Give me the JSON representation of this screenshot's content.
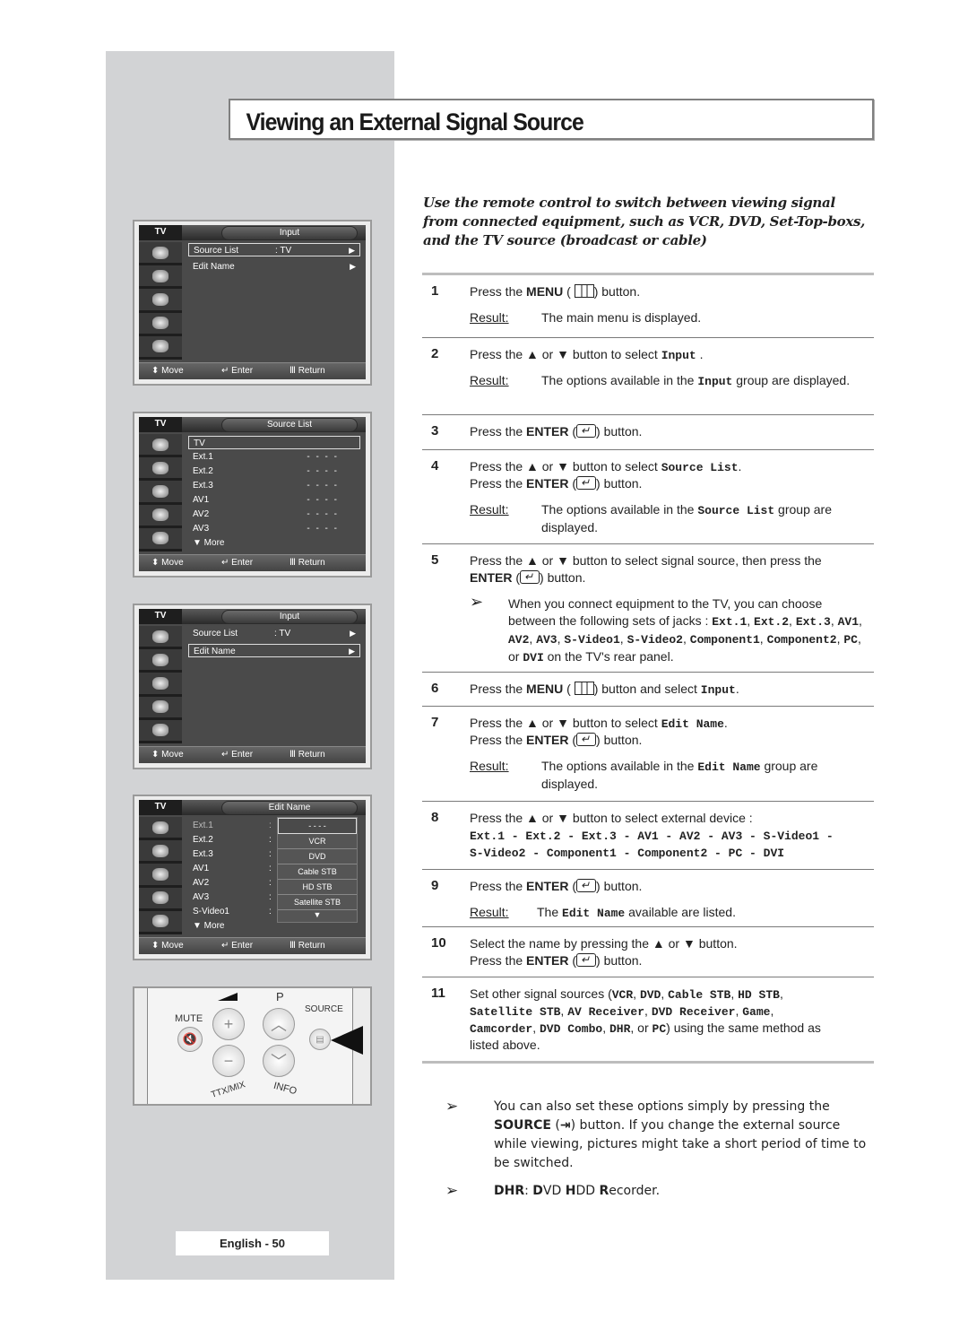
{
  "page": {
    "title": "Viewing an External Signal Source",
    "page_number": "English - 50",
    "intro": "Use the remote control to switch between viewing signal from connected equipment, such as VCR, DVD, Set-Top-boxs, and the TV source (broadcast or cable)"
  },
  "osd_screens": [
    {
      "tv_label": "TV",
      "header": "Input",
      "rows": [
        {
          "label": "Source List",
          "value": ": TV",
          "arrow": "▶",
          "selected": true
        },
        {
          "label": "Edit Name",
          "value": "",
          "arrow": "▶",
          "selected": false
        }
      ],
      "footer": {
        "move": "Move",
        "enter": "Enter",
        "return": "Return"
      }
    },
    {
      "tv_label": "TV",
      "header": "Source List",
      "rows": [
        {
          "label": "TV",
          "value": "",
          "selected": true
        },
        {
          "label": "Ext.1",
          "value": "- - - -"
        },
        {
          "label": "Ext.2",
          "value": "- - - -"
        },
        {
          "label": "Ext.3",
          "value": "- - - -"
        },
        {
          "label": "AV1",
          "value": "- - - -"
        },
        {
          "label": "AV2",
          "value": "- - - -"
        },
        {
          "label": "AV3",
          "value": "- - - -"
        },
        {
          "label": "▼ More",
          "value": ""
        }
      ],
      "footer": {
        "move": "Move",
        "enter": "Enter",
        "return": "Return"
      }
    },
    {
      "tv_label": "TV",
      "header": "Input",
      "rows": [
        {
          "label": "Source List",
          "value": ": TV",
          "arrow": "▶",
          "selected": false
        },
        {
          "label": "Edit Name",
          "value": "",
          "arrow": "▶",
          "selected": true
        }
      ],
      "footer": {
        "move": "Move",
        "enter": "Enter",
        "return": "Return"
      }
    },
    {
      "tv_label": "TV",
      "header": "Edit Name",
      "rows": [
        {
          "label": "Ext.1",
          "colon": ":"
        },
        {
          "label": "Ext.2",
          "colon": ":"
        },
        {
          "label": "Ext.3",
          "colon": ":"
        },
        {
          "label": "AV1",
          "colon": ":"
        },
        {
          "label": "AV2",
          "colon": ":"
        },
        {
          "label": "AV3",
          "colon": ":"
        },
        {
          "label": "S-Video1",
          "colon": ":"
        },
        {
          "label": "▼ More",
          "colon": ""
        }
      ],
      "dropdown": {
        "current": "- - - -",
        "options": [
          "VCR",
          "DVD",
          "Cable STB",
          "HD STB",
          "Satellite STB"
        ],
        "more": "▼"
      },
      "footer": {
        "move": "Move",
        "enter": "Enter",
        "return": "Return"
      }
    }
  ],
  "remote": {
    "mute": "MUTE",
    "p": "P",
    "source": "SOURCE",
    "ttx": "TTX/MIX",
    "info": "INFO",
    "vol_up": "+",
    "vol_down": "−",
    "ch_up": "︿",
    "ch_down": "﹀"
  },
  "steps": [
    {
      "num": "1",
      "lines": [
        "Press the <b>MENU</b> ( <i class='menu-ico'></i>) button."
      ],
      "result": "The main menu is displayed."
    },
    {
      "num": "2",
      "lines": [
        "Press the ▲ or ▼ button to select <span class='mono'>Input</span> ."
      ],
      "result": "The options available in the <span class='mono'>Input</span> group are displayed."
    },
    {
      "num": "3",
      "lines": [
        "Press the <b>ENTER</b> (<i class='enter-ico'></i>) button."
      ]
    },
    {
      "num": "4",
      "lines": [
        "Press the ▲ or ▼ button to select <span class='mono'>Source List</span>.",
        "Press the <b>ENTER</b> (<i class='enter-ico'></i>) button."
      ],
      "result": "The options available in the <span class='mono'>Source List</span> group are displayed."
    },
    {
      "num": "5",
      "lines": [
        "Press the ▲ or ▼ button to select signal source, then press the",
        "<b>ENTER</b> (<i class='enter-ico'></i>) button."
      ],
      "note": "When you connect equipment to the TV, you can choose between the following sets of jacks : <span class='mono'>Ext.1</span>, <span class='mono'>Ext.2</span>, <span class='mono'>Ext.3</span>, <span class='mono'>AV1</span>, <span class='mono'>AV2</span>, <span class='mono'>AV3</span>, <span class='mono'>S-Video1</span>, <span class='mono'>S-Video2</span>, <span class='mono'>Component1</span>, <span class='mono'>Component2</span>, <span class='mono'>PC</span>, or <span class='mono'>DVI</span>  on the TV's rear panel."
    },
    {
      "num": "6",
      "lines": [
        "Press the <b>MENU</b> ( <i class='menu-ico'></i>) button and select <span class='mono'>Input</span>."
      ]
    },
    {
      "num": "7",
      "lines": [
        "Press the ▲ or ▼ button to select <span class='mono'>Edit Name</span>.",
        "Press the <b>ENTER</b> (<i class='enter-ico'></i>) button."
      ],
      "result": "The options available in the <span class='mono'>Edit Name</span> group are displayed."
    },
    {
      "num": "8",
      "lines": [
        "Press the ▲ or ▼ button to select external device :",
        "<span class='mono'>Ext.1 - Ext.2 - Ext.3 - AV1 - AV2 - AV3 - S-Video1 -</span>",
        "<span class='mono'>S-Video2 - Component1 - Component2 - PC - DVI</span>"
      ]
    },
    {
      "num": "9",
      "lines": [
        "Press the <b>ENTER</b> (<i class='enter-ico'></i>) button."
      ],
      "result": "The <span class='mono'>Edit Name</span> available are listed."
    },
    {
      "num": "10",
      "lines": [
        "Select the name by pressing the ▲ or ▼ button.",
        "Press the <b>ENTER</b> (<i class='enter-ico'></i>) button."
      ]
    },
    {
      "num": "11",
      "lines": [
        "Set other signal sources (<span class='mono'>VCR</span>, <span class='mono'>DVD</span>, <span class='mono'>Cable STB</span>, <span class='mono'>HD STB</span>,",
        "<span class='mono'>Satellite STB</span>, <span class='mono'>AV Receiver</span>, <span class='mono'>DVD Receiver</span>, <span class='mono'>Game</span>,",
        "<span class='mono'>Camcorder</span>, <span class='mono'>DVD Combo</span>, <span class='mono'>DHR</span>, or <span class='mono'>PC</span>) using the same method as",
        "listed above."
      ]
    }
  ],
  "result_label": "Result:",
  "notes": [
    "You can also set these options simply by pressing the <b>SOURCE</b> (<b>⇥</b>) button. If you change the external source while viewing, pictures might take a short period of time to be switched.",
    "<b>DHR</b>: <b>D</b>VD <b>H</b>DD <b>R</b>ecorder."
  ],
  "note_arrow": "➢"
}
